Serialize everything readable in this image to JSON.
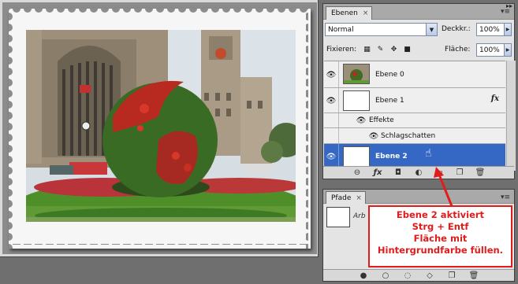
{
  "layers_panel": {
    "tab_label": "Ebenen",
    "close": "×",
    "menu_icon": "panel-menu-icon",
    "blend_mode": "Normal",
    "opacity_label": "Deckkr.:",
    "opacity_value": "100%",
    "lock_label": "Fixieren:",
    "fill_label": "Fläche:",
    "fill_value": "100%",
    "layers": [
      {
        "name": "Ebene 0",
        "selected": false
      },
      {
        "name": "Ebene 1",
        "selected": false,
        "fx": "fx"
      },
      {
        "name": "Effekte"
      },
      {
        "name": "Schlagschatten"
      },
      {
        "name": "Ebene 2",
        "selected": true
      }
    ]
  },
  "paths_panel": {
    "tab_label": "Pfade",
    "close": "×",
    "path_name": "Arb"
  },
  "annotation": {
    "line1": "Ebene 2 aktiviert",
    "line2": "Strg + Entf",
    "line3": "Fläche mit",
    "line4": "Hintergrundfarbe füllen."
  },
  "colors": {
    "selection": "#3568c4",
    "annotation_red": "#e21b1b",
    "panel_bg": "#e4e4e4"
  }
}
